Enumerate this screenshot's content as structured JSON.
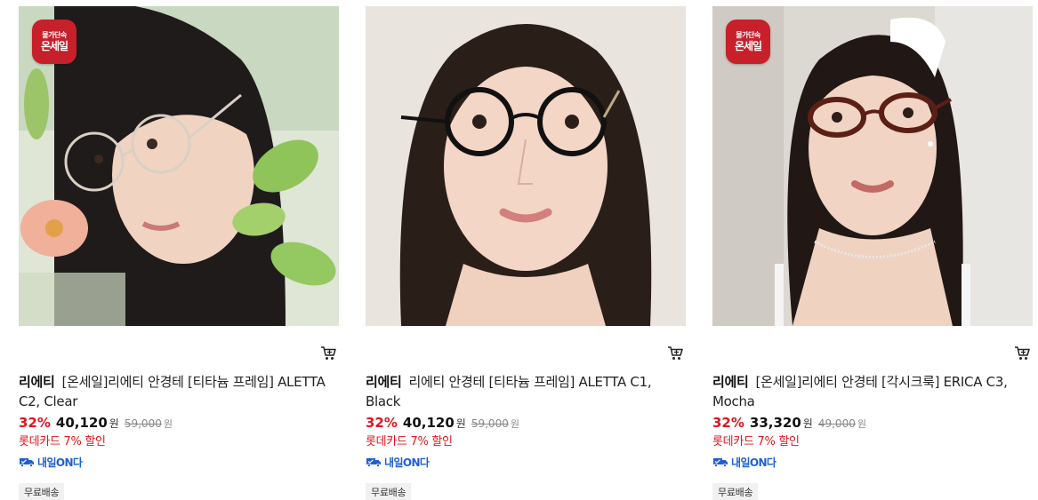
{
  "products": [
    {
      "badge": {
        "line1": "물가단속",
        "line2": "온세일"
      },
      "brand": "리에티",
      "name": "[온세일]리에티 안경테 [티타늄 프레임] ALETTA C2, Clear",
      "discount_rate": "32%",
      "sale_price": "40,120",
      "currency": "원",
      "original_price": "59,000",
      "card_benefit": "롯데카드 7% 할인",
      "delivery_label": "내일ON다",
      "free_shipping": "무료배송",
      "icon": "cart-icon"
    },
    {
      "badge": null,
      "brand": "리에티",
      "name": "리에티 안경테 [티타늄 프레임] ALETTA C1, Black",
      "discount_rate": "32%",
      "sale_price": "40,120",
      "currency": "원",
      "original_price": "59,000",
      "card_benefit": "롯데카드 7% 할인",
      "delivery_label": "내일ON다",
      "free_shipping": "무료배송",
      "icon": "cart-icon"
    },
    {
      "badge": {
        "line1": "물가단속",
        "line2": "온세일"
      },
      "brand": "리에티",
      "name": "[온세일]리에티 안경테 [각시크룩] ERICA C3, Mocha",
      "discount_rate": "32%",
      "sale_price": "33,320",
      "currency": "원",
      "original_price": "49,000",
      "card_benefit": "롯데카드 7% 할인",
      "delivery_label": "내일ON다",
      "free_shipping": "무료배송",
      "icon": "cart-icon"
    }
  ],
  "colors": {
    "discount": "#e0161e",
    "delivery": "#1f5fd4",
    "badge": "#c8202a"
  }
}
